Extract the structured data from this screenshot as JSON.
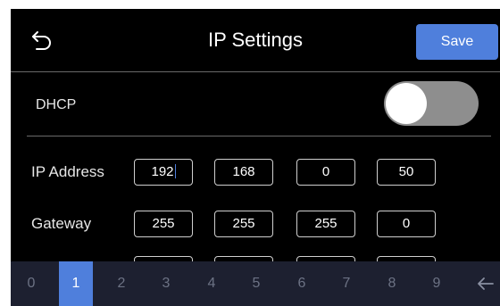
{
  "header": {
    "title": "IP Settings",
    "save_label": "Save",
    "back_icon": "back-arrow-icon"
  },
  "dhcp": {
    "label": "DHCP",
    "enabled": false
  },
  "ip_address": {
    "label": "IP Address",
    "octets": [
      "192",
      "168",
      "0",
      "50"
    ]
  },
  "gateway": {
    "label": "Gateway",
    "octets": [
      "255",
      "255",
      "255",
      "0"
    ]
  },
  "keyboard": {
    "keys": [
      "0",
      "1",
      "2",
      "3",
      "4",
      "5",
      "6",
      "7",
      "8",
      "9"
    ],
    "active_key": "1",
    "backspace_icon": "backspace-arrow-icon"
  },
  "colors": {
    "accent": "#4f7fdc",
    "background": "#000000",
    "keyboard_bg": "#1d2030",
    "toggle_off": "#8e8e8e"
  }
}
